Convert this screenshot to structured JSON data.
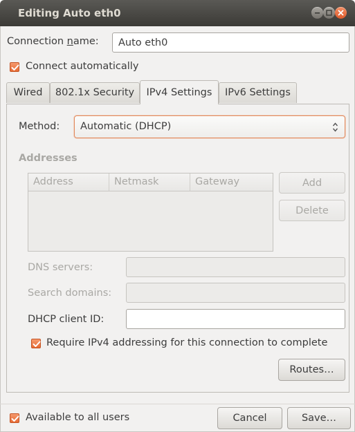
{
  "window": {
    "title": "Editing Auto eth0",
    "accent_color": "#e76a34"
  },
  "connection": {
    "name_label_pre": "Connection ",
    "name_label_mnemonic": "n",
    "name_label_post": "ame:",
    "name_value": "Auto eth0",
    "connect_automatically_label": "Connect automatically",
    "connect_automatically_checked": true
  },
  "tabs": [
    {
      "label": "Wired",
      "active": false
    },
    {
      "label": "802.1x Security",
      "active": false
    },
    {
      "label": "IPv4 Settings",
      "active": true
    },
    {
      "label": "IPv6 Settings",
      "active": false
    }
  ],
  "ipv4": {
    "method_label": "Method:",
    "method_value": "Automatic (DHCP)",
    "addresses_heading": "Addresses",
    "address_columns": [
      "Address",
      "Netmask",
      "Gateway"
    ],
    "add_button": "Add",
    "delete_button": "Delete",
    "dns_servers_label": "DNS servers:",
    "dns_servers_value": "",
    "search_domains_label": "Search domains:",
    "search_domains_value": "",
    "dhcp_client_id_label": "DHCP client ID:",
    "dhcp_client_id_value": "",
    "require_ipv4_label": "Require IPv4 addressing for this connection to complete",
    "require_ipv4_checked": true,
    "routes_button": "Routes…"
  },
  "footer": {
    "available_to_all_label": "Available to all users",
    "available_to_all_checked": true,
    "cancel_button": "Cancel",
    "save_button": "Save…"
  }
}
